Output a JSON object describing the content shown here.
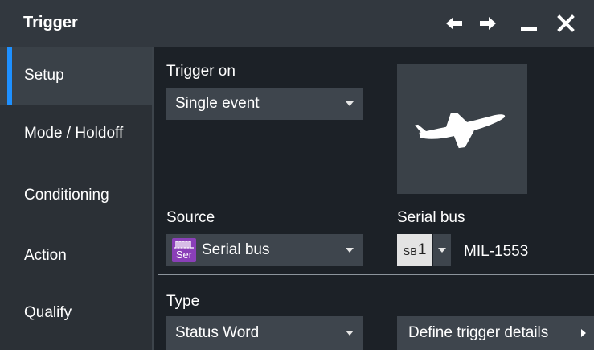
{
  "window": {
    "title": "Trigger",
    "controls": [
      "arrow-left-icon",
      "arrow-right-icon",
      "minimize-icon",
      "close-icon"
    ]
  },
  "sidebar": {
    "items": [
      {
        "label": "Setup",
        "active": true
      },
      {
        "label": "Mode / Holdoff",
        "active": false
      },
      {
        "label": "Conditioning",
        "active": false
      },
      {
        "label": "Action",
        "active": false
      },
      {
        "label": "Qualify",
        "active": false
      }
    ]
  },
  "setup": {
    "trigger_on": {
      "label": "Trigger on",
      "value": "Single event"
    },
    "preview_icon": "airplane-icon",
    "source": {
      "label": "Source",
      "value": "Serial bus",
      "icon_text": "Ser"
    },
    "serial_bus": {
      "label": "Serial bus",
      "badge_prefix": "SB",
      "badge_number": "1",
      "protocol": "MIL-1553"
    },
    "type": {
      "label": "Type",
      "value": "Status Word"
    },
    "define_button": "Define trigger details"
  },
  "colors": {
    "accent": "#1e90ff",
    "serial_icon": "#8a3fb8",
    "background": "#1c2127",
    "panel": "#3e454d"
  }
}
